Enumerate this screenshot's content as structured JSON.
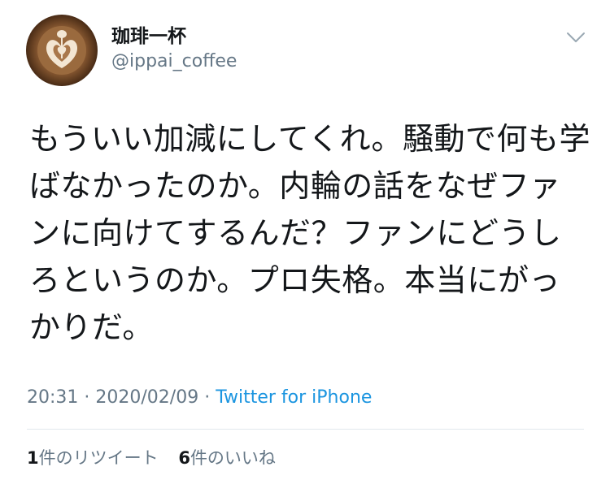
{
  "tweet": {
    "display_name": "珈琲一杯",
    "handle": "@ippai_coffee",
    "text": "もういい加減にしてくれ。騒動で何も学ばなかったのか。内輪の話をなぜファンに向けてするんだ？ファンにどうしろというのか。プロ失格。本当にがっかりだ。",
    "time": "20:31",
    "date": "2020/02/09",
    "separator": " · ",
    "source": "Twitter for iPhone",
    "retweet_count": "1",
    "retweet_label": "件のリツイート",
    "like_count": "6",
    "like_label": "件のいいね"
  },
  "icons": {
    "avatar": "latte-art-avatar",
    "menu": "chevron-down-icon"
  },
  "colors": {
    "text": "#14171a",
    "secondary": "#657786",
    "link": "#1b95e0",
    "divider": "#e1e8ed"
  }
}
